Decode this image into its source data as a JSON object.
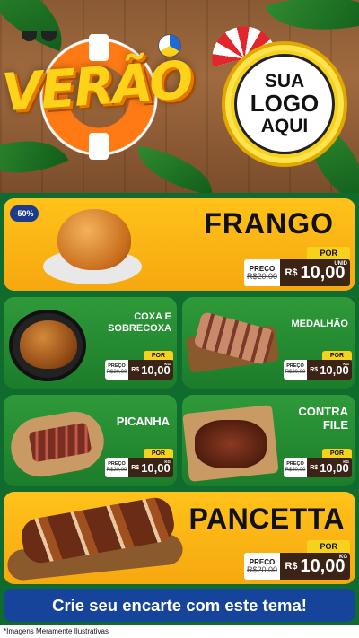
{
  "header": {
    "title": "VERÃO",
    "logo": {
      "line1": "SUA",
      "line2": "LOGO",
      "line3": "AQUI"
    }
  },
  "products": [
    {
      "id": "frango",
      "name": "FRANGO",
      "badge": "-50%",
      "por": "POR",
      "preco_label": "PREÇO",
      "old": "R$20,00",
      "currency": "R$",
      "price": "10,00",
      "unit": "UNID"
    },
    {
      "id": "coxa",
      "name_line1": "COXA E",
      "name_line2": "SOBRECOXA",
      "por": "POR",
      "preco_label": "PREÇO",
      "old": "R$20,00",
      "currency": "R$",
      "price": "10,00",
      "unit": "KG"
    },
    {
      "id": "medalhao",
      "name": "MEDALHÃO",
      "por": "POR",
      "preco_label": "PREÇO",
      "old": "R$20,00",
      "currency": "R$",
      "price": "10,00",
      "unit": "KG"
    },
    {
      "id": "picanha",
      "name": "PICANHA",
      "por": "POR",
      "preco_label": "PREÇO",
      "old": "R$20,00",
      "currency": "R$",
      "price": "10,00",
      "unit": "KG"
    },
    {
      "id": "contrafile",
      "name_line1": "CONTRA",
      "name_line2": "FILE",
      "por": "POR",
      "preco_label": "PREÇO",
      "old": "R$20,00",
      "currency": "R$",
      "price": "10,00",
      "unit": "KG"
    },
    {
      "id": "pancetta",
      "name": "PANCETTA",
      "por": "POR",
      "preco_label": "PREÇO",
      "old": "R$20,00",
      "currency": "R$",
      "price": "10,00",
      "unit": "KG"
    }
  ],
  "cta": "Crie seu encarte com este tema!",
  "footer": "*Imagens Meramente Ilustrativas",
  "colors": {
    "accent_yellow": "#f6a80f",
    "card_green": "#1c7c2a",
    "cta_blue": "#17449b",
    "price_brown": "#3b2316"
  }
}
